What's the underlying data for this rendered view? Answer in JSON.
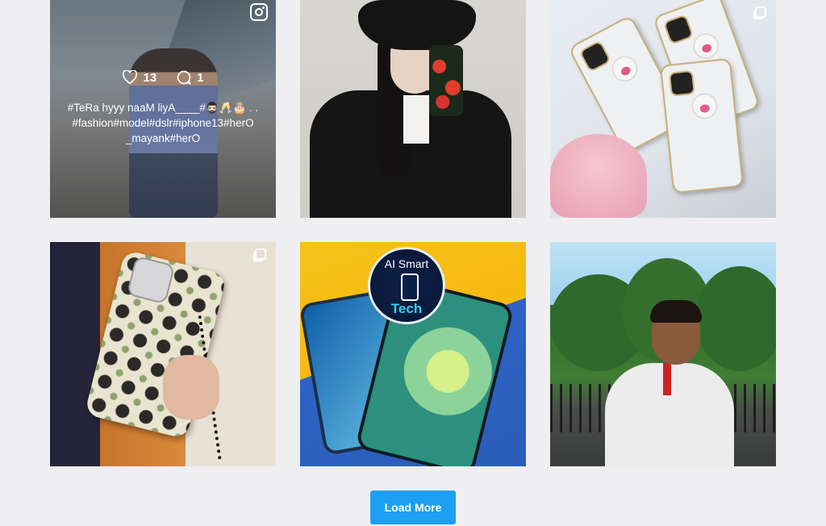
{
  "feed": {
    "posts": [
      {
        "likes": "13",
        "comments": "1",
        "caption_line1": "#TeRa hyyy naaM liyA____#🧔🏻‍♂️🥂🎂 . .",
        "caption_line2": "#fashion#model#dslr#iphone13#herO",
        "caption_line3": "_mayank#herO",
        "badge_icon": "instagram-icon"
      },
      {
        "badge_icon": "none"
      },
      {
        "badge_icon": "multi-image-icon"
      },
      {
        "badge_icon": "multi-image-icon"
      },
      {
        "logo_top": "AI Smart",
        "logo_bottom": "Tech",
        "badge_icon": "none"
      },
      {
        "badge_icon": "none"
      }
    ],
    "load_more_label": "Load More"
  },
  "colors": {
    "background": "#efeff1",
    "button": "#1d9ff2"
  }
}
